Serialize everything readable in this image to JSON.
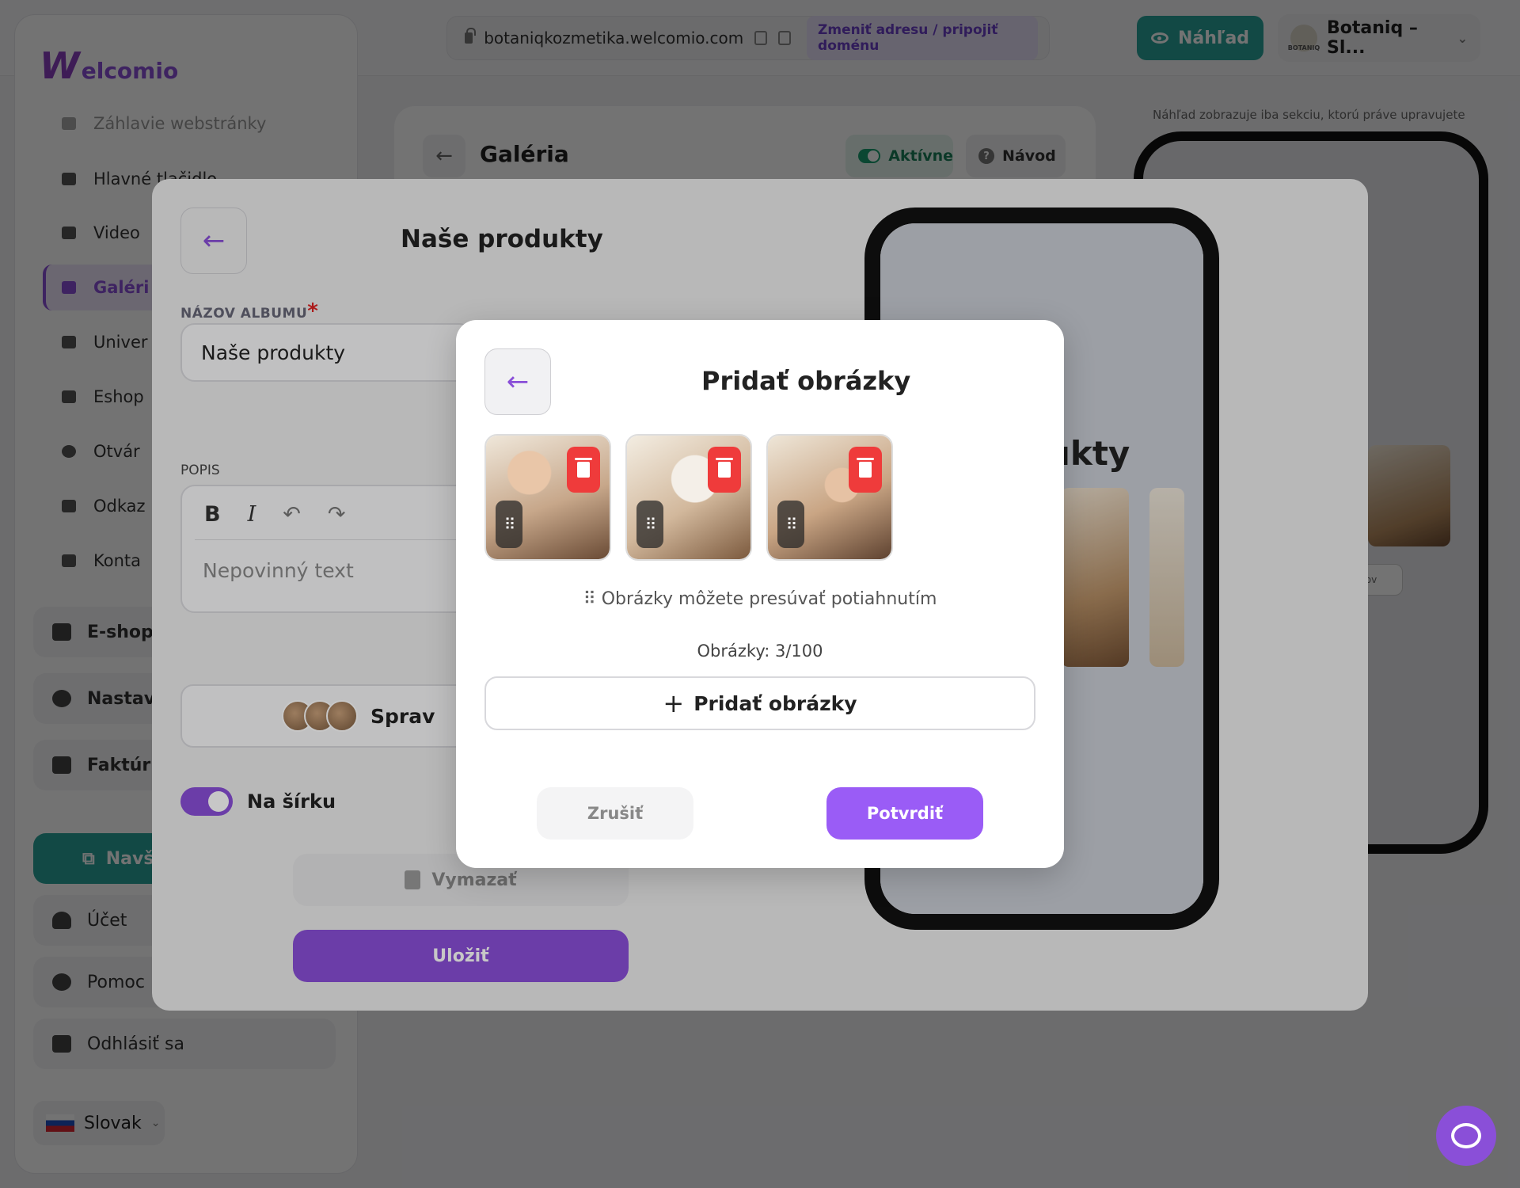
{
  "topbar": {
    "url": "botaniqkozmetika.welcomio.com",
    "change_domain": "Zmeniť adresu / pripojiť doménu",
    "preview_button": "Náhľad",
    "brand_name": "Botaniq – Sl...",
    "brand_logo_text": "BOTANIQ"
  },
  "sidebar": {
    "logo_w": "W",
    "logo_text": "elcomio",
    "items": [
      {
        "label": "Záhlavie webstránky",
        "icon": "header-icon"
      },
      {
        "label": "Hlavné tlačidlo",
        "icon": "megaphone-icon"
      },
      {
        "label": "Video",
        "icon": "video-icon"
      },
      {
        "label": "Galéri",
        "icon": "gallery-icon"
      },
      {
        "label": "Univer",
        "icon": "tag-icon"
      },
      {
        "label": "Eshop",
        "icon": "cart-icon"
      },
      {
        "label": "Otvár",
        "icon": "clock-icon"
      },
      {
        "label": "Odkaz",
        "icon": "link-icon"
      },
      {
        "label": "Konta",
        "icon": "contact-icon"
      }
    ],
    "groups": [
      {
        "label": "E-shop",
        "icon": "cart-icon"
      },
      {
        "label": "Nastav",
        "icon": "gear-icon"
      },
      {
        "label": "Faktúr",
        "icon": "invoice-icon"
      }
    ],
    "navs_button": "Navš",
    "account": "Účet",
    "help": "Pomoc",
    "logout": "Odhlásiť sa",
    "language": "Slovak"
  },
  "gallery": {
    "title": "Galéria",
    "active_chip": "Aktívne",
    "guide_chip": "Návod",
    "preview_note": "Náhľad zobrazuje iba sekciu, ktorú práve upravujete",
    "preview_btn": "ov"
  },
  "album_modal": {
    "title": "Naše produkty",
    "album_name_label": "NÁZOV ALBUMU",
    "required_mark": "*",
    "album_name_value": "Naše produkty",
    "description_label": "POPIS",
    "toolbar": {
      "bold": "B",
      "italic": "I",
      "undo": "↶",
      "redo": "↷"
    },
    "description_placeholder": "Nepovinný text",
    "manage_button": "Sprav",
    "landscape_label": "Na šírku",
    "delete_button": "Vymazať",
    "save_button": "Uložiť",
    "phone_title": "ukty"
  },
  "add_images_modal": {
    "title": "Pridať obrázky",
    "images": [
      "image-1",
      "image-2",
      "image-3"
    ],
    "drag_hint": "Obrázky môžete presúvať potiahnutím",
    "count_text": "Obrázky: 3/100",
    "add_button": "Pridať obrázky",
    "cancel_button": "Zrušiť",
    "confirm_button": "Potvrdiť"
  },
  "colors": {
    "accent": "#8a4fd8",
    "teal": "#2aa39a",
    "danger": "#ef3b3b",
    "confirm": "#9a5cf6"
  }
}
